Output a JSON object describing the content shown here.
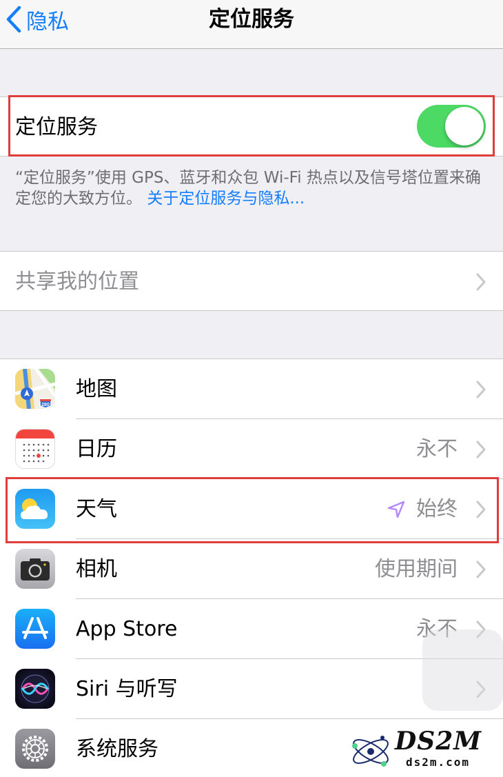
{
  "nav": {
    "back_label": "隐私",
    "title": "定位服务"
  },
  "location_services": {
    "label": "定位服务",
    "enabled": true,
    "toggle_color": "#4cd964"
  },
  "footnote": {
    "text": "“定位服务”使用 GPS、蓝牙和众包 Wi-Fi 热点以及信号塔位置来确定您的大致方位。",
    "link": "关于定位服务与隐私..."
  },
  "share": {
    "label": "共享我的位置"
  },
  "apps": [
    {
      "name": "地图",
      "value": "",
      "icon": "maps-icon"
    },
    {
      "name": "日历",
      "value": "永不",
      "icon": "calendar-icon"
    },
    {
      "name": "天气",
      "value": "始终",
      "icon": "weather-icon",
      "location_arrow": "location-arrow-icon"
    },
    {
      "name": "相机",
      "value": "使用期间",
      "icon": "camera-icon"
    },
    {
      "name": "App Store",
      "value": "永不",
      "icon": "app-store-icon"
    },
    {
      "name": "Siri 与听写",
      "value": "",
      "icon": "siri-icon"
    },
    {
      "name": "系统服务",
      "value": "",
      "icon": "gear-icon"
    }
  ],
  "watermark": {
    "title": "DS2M",
    "subtitle": "ds2m.com"
  },
  "colors": {
    "accent": "#147efb",
    "highlight": "#e03c3c",
    "location_arrow": "#b388ff"
  }
}
